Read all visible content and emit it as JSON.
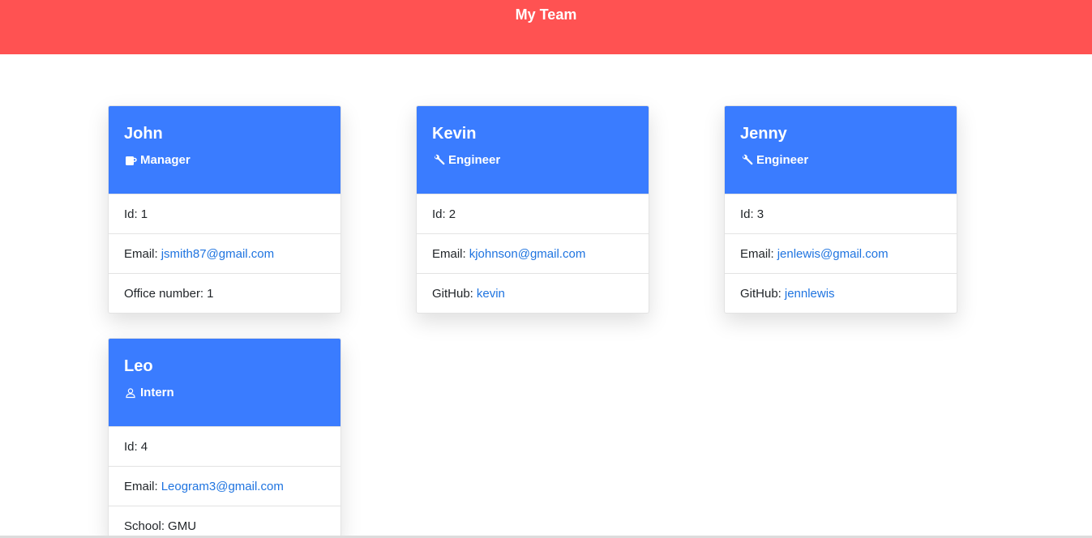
{
  "header": {
    "title": "My Team"
  },
  "colors": {
    "banner": "#ff5252",
    "card_header": "#3a7cff",
    "link": "#1f74e0"
  },
  "employees": [
    {
      "name": "John",
      "role": "Manager",
      "role_icon": "mug-icon",
      "id_label": "Id:",
      "id": "1",
      "email_label": "Email:",
      "email": "jsmith87@gmail.com",
      "extra_label": "Office number:",
      "extra_value": "1"
    },
    {
      "name": "Kevin",
      "role": "Engineer",
      "role_icon": "wrench-icon",
      "id_label": "Id:",
      "id": "2",
      "email_label": "Email:",
      "email": "kjohnson@gmail.com",
      "extra_label": "GitHub:",
      "extra_value": "kevin"
    },
    {
      "name": "Jenny",
      "role": "Engineer",
      "role_icon": "wrench-icon",
      "id_label": "Id:",
      "id": "3",
      "email_label": "Email:",
      "email": "jenlewis@gmail.com",
      "extra_label": "GitHub:",
      "extra_value": "jennlewis"
    },
    {
      "name": "Leo",
      "role": "Intern",
      "role_icon": "person-icon",
      "id_label": "Id:",
      "id": "4",
      "email_label": "Email:",
      "email": "Leogram3@gmail.com",
      "extra_label": "School:",
      "extra_value": "GMU"
    }
  ]
}
